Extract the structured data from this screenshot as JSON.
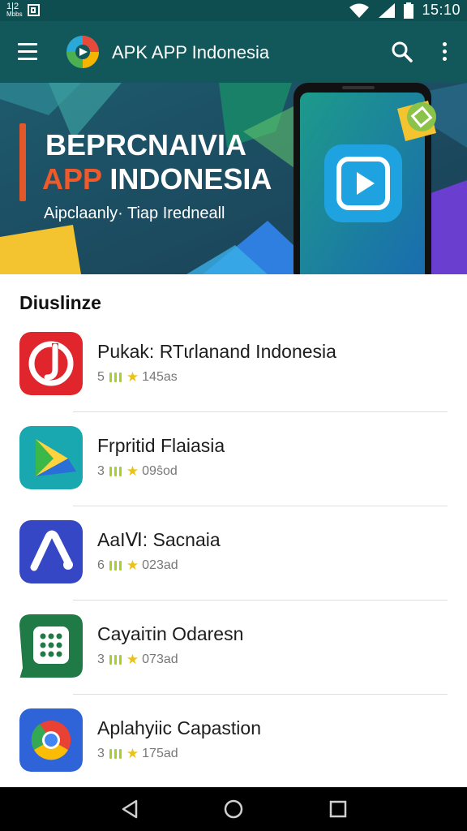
{
  "status_bar": {
    "left_top": "1|2",
    "left_bottom": "Mbbs",
    "time": "15:10",
    "icons": [
      "sim-icon",
      "wifi-icon",
      "signal-icon",
      "battery-icon"
    ]
  },
  "app_bar": {
    "title": "APK APP Indonesia",
    "icons": [
      "menu-icon",
      "app-logo-icon",
      "search-icon",
      "more-vert-icon"
    ]
  },
  "banner": {
    "line1": "BEPRCNAIVIA",
    "line2_accent": "APP",
    "line2_rest": " INDONESIA",
    "line3": "Aipclaanly· Tiap Iredneall",
    "icons": [
      "phone-illustration",
      "play-icon",
      "tag-badge-icon"
    ]
  },
  "section": {
    "title": "Diuslinze"
  },
  "apps": [
    {
      "name": "Pukak: RTɩɾlanand Indonesia",
      "rating": "5",
      "size": "145as",
      "icon": "red-music-icon",
      "icon_color": "#e0262c"
    },
    {
      "name": "Frpritid Flaiasia",
      "rating": "3",
      "size": "09ŝod",
      "icon": "teal-triangle-icon",
      "icon_color": "#19a7b0"
    },
    {
      "name": "AaIⅥ: Sacnaia",
      "rating": "6",
      "size": "023ad",
      "icon": "blue-lambda-icon",
      "icon_color": "#3547c4"
    },
    {
      "name": "Cayaiτin Odaresn",
      "rating": "3",
      "size": "073ad",
      "icon": "green-grid-icon",
      "icon_color": "#1f7a45"
    },
    {
      "name": "Aplahyiic Capastion",
      "rating": "3",
      "size": "175ad",
      "icon": "chrome-icon",
      "icon_color": "#2f64d8"
    }
  ],
  "nav_bar": {
    "icons": [
      "back-icon",
      "home-icon",
      "recents-icon"
    ]
  },
  "colors": {
    "app_bar": "#12585b",
    "status_bar": "#0e4e50",
    "accent": "#f05a2a",
    "rating_green": "#a6d12a",
    "star": "#e9c21a"
  }
}
